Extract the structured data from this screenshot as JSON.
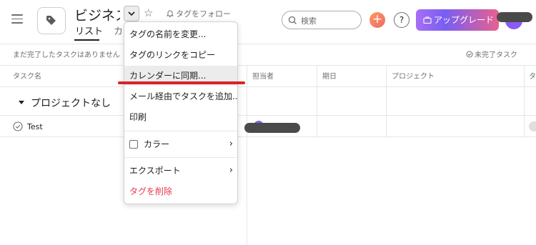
{
  "header": {
    "title": "ビジネス",
    "follow_label": "タグをフォロー",
    "tabs": [
      {
        "label": "リスト"
      },
      {
        "label": "カレンダー"
      }
    ],
    "search_placeholder": "検索",
    "plus_label": "+",
    "help_label": "?",
    "upgrade_label": "アップグレード"
  },
  "toolbar": {
    "status_text": "まだ完了したタスクはありません",
    "incomplete_label": "未完了タスク"
  },
  "table": {
    "columns": [
      "タスク名",
      "担当者",
      "期日",
      "プロジェクト",
      "タ"
    ],
    "section_label": "プロジェクトなし",
    "rows": [
      {
        "task": "Test"
      }
    ]
  },
  "menu": {
    "items": [
      {
        "label": "タグの名前を変更..."
      },
      {
        "label": "タグのリンクをコピー"
      },
      {
        "label": "カレンダーに同期..."
      },
      {
        "label": "メール経由でタスクを追加..."
      },
      {
        "label": "印刷"
      },
      {
        "label": "カラー"
      },
      {
        "label": "エクスポート"
      },
      {
        "label": "タグを削除"
      }
    ],
    "highlighted_index": 2
  },
  "colors": {
    "upgrade_gradient": [
      "#a76ff3",
      "#e9608e"
    ],
    "danger": "#e8384f",
    "annotation_underline": "#d8232a",
    "avatar": "#8a5cf5"
  }
}
